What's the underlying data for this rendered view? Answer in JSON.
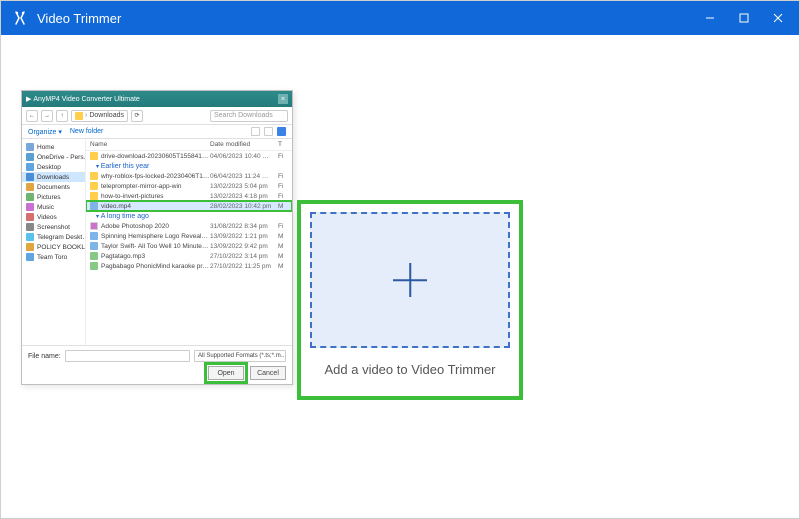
{
  "app": {
    "title": "Video Trimmer"
  },
  "dropzone": {
    "caption": "Add a video to Video Trimmer"
  },
  "dialog": {
    "title": "AnyMP4 Video Converter Ultimate",
    "breadcrumb_icon": "downloads-folder-icon",
    "breadcrumb": "Downloads",
    "search_placeholder": "Search Downloads",
    "toolbar": {
      "organize": "Organize ▾",
      "new_folder": "New folder"
    },
    "sidebar": [
      {
        "icon": "ic-home",
        "label": "Home"
      },
      {
        "icon": "ic-cloud",
        "label": "OneDrive - Pers…"
      },
      {
        "icon": "ic-desktop",
        "label": "Desktop"
      },
      {
        "icon": "ic-dl",
        "label": "Downloads",
        "selected": true
      },
      {
        "icon": "ic-doc",
        "label": "Documents"
      },
      {
        "icon": "ic-pic",
        "label": "Pictures"
      },
      {
        "icon": "ic-music",
        "label": "Music"
      },
      {
        "icon": "ic-vid",
        "label": "Videos"
      },
      {
        "icon": "ic-ss",
        "label": "Screenshot"
      },
      {
        "icon": "ic-tg",
        "label": "Telegram Deskt…"
      },
      {
        "icon": "ic-pb",
        "label": "POLICY BOOKLE…"
      },
      {
        "icon": "ic-tt",
        "label": "Team Toro"
      }
    ],
    "columns": {
      "name": "Name",
      "date": "Date modified",
      "type": "T"
    },
    "rows": [
      {
        "group": null,
        "icon": "folder",
        "name": "drive-download-20230605T155841Z-001",
        "date": "04/06/2023 10:40 …",
        "type": "Fi"
      },
      {
        "group": "Earlier this year"
      },
      {
        "group": null,
        "icon": "folder",
        "name": "why-roblox-fps-locked-20230406T152414…",
        "date": "06/04/2023 11:24 …",
        "type": "Fi"
      },
      {
        "group": null,
        "icon": "folder",
        "name": "teleprompter-mirror-app-win",
        "date": "13/02/2023 5:04 pm",
        "type": "Fi"
      },
      {
        "group": null,
        "icon": "folder",
        "name": "how-to-invert-pictures",
        "date": "13/02/2023 4:18 pm",
        "type": "Fi"
      },
      {
        "group": null,
        "icon": "video",
        "name": "video.mp4",
        "date": "28/02/2023 10:42 pm",
        "type": "M",
        "selected": true
      },
      {
        "group": "A long time ago"
      },
      {
        "group": null,
        "icon": "app",
        "name": "Adobe Photoshop 2020",
        "date": "31/08/2022 8:34 pm",
        "type": "Fi"
      },
      {
        "group": null,
        "icon": "video",
        "name": "Spinning Hemisphere Logo Reveal_free…",
        "date": "13/09/2022 1:21 pm",
        "type": "M"
      },
      {
        "group": null,
        "icon": "video",
        "name": "Taylor Swift- All Too Well 10 Minute Versi…",
        "date": "13/09/2022 9:42 pm",
        "type": "M"
      },
      {
        "group": null,
        "icon": "audio",
        "name": "Pagtatago.mp3",
        "date": "27/10/2022 3:14 pm",
        "type": "M"
      },
      {
        "group": null,
        "icon": "audio",
        "name": "Pagbabago PhonicMind karaoke previe…",
        "date": "27/10/2022 11:25 pm",
        "type": "M"
      }
    ],
    "filename_label": "File name:",
    "filter": "All Supported Formats (*.ts;*.m…",
    "open": "Open",
    "cancel": "Cancel"
  }
}
